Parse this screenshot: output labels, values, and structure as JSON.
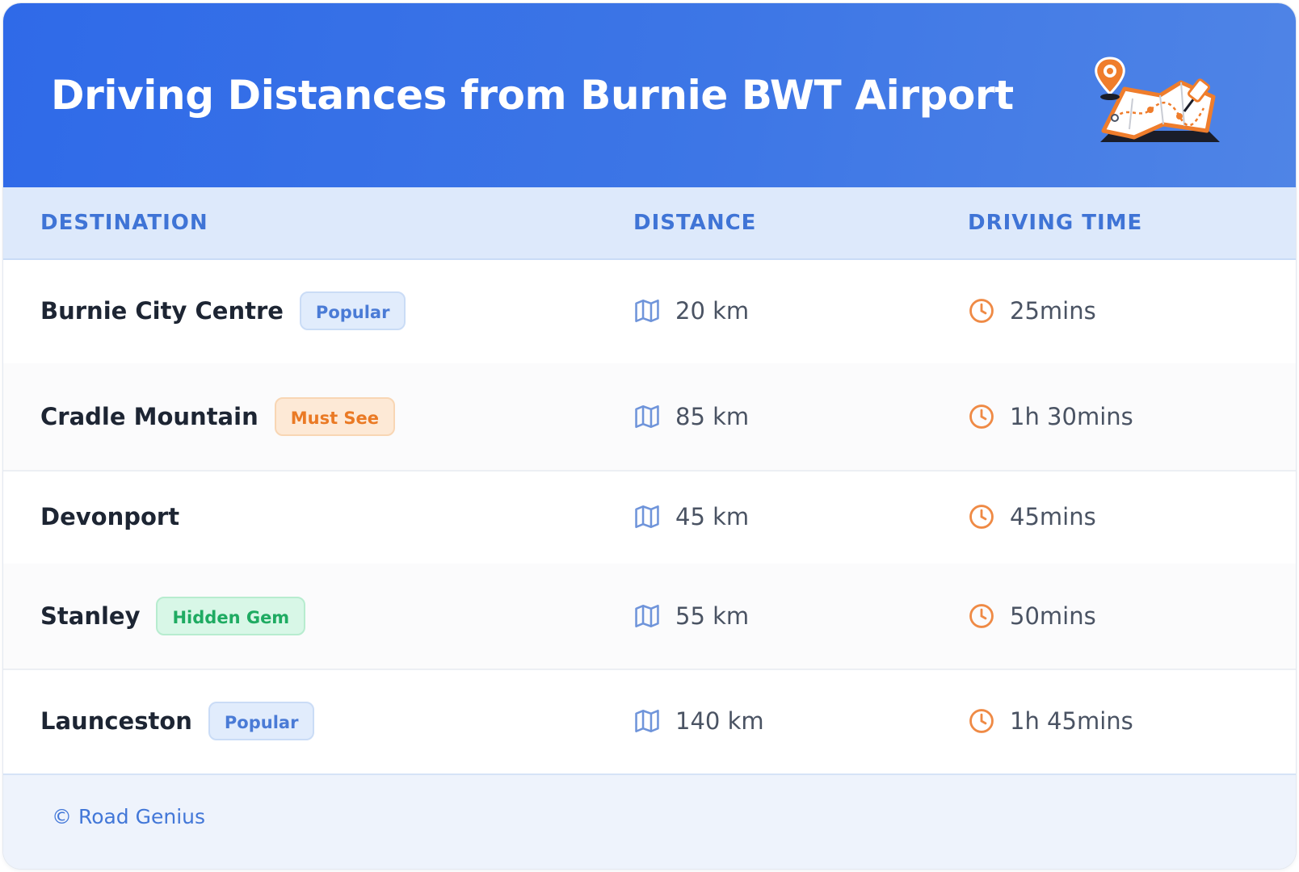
{
  "header": {
    "title": "Driving Distances from Burnie BWT Airport"
  },
  "table": {
    "columns": [
      "DESTINATION",
      "DISTANCE",
      "DRIVING TIME"
    ],
    "rows": [
      {
        "destination": "Burnie City Centre",
        "badge": "Popular",
        "badge_type": "popular",
        "distance": "20 km",
        "time": "25mins"
      },
      {
        "destination": "Cradle Mountain",
        "badge": "Must See",
        "badge_type": "mustsee",
        "distance": "85 km",
        "time": "1h 30mins"
      },
      {
        "destination": "Devonport",
        "badge": "",
        "badge_type": "",
        "distance": "45 km",
        "time": "45mins"
      },
      {
        "destination": "Stanley",
        "badge": "Hidden Gem",
        "badge_type": "gem",
        "distance": "55 km",
        "time": "50mins"
      },
      {
        "destination": "Launceston",
        "badge": "Popular",
        "badge_type": "popular",
        "distance": "140 km",
        "time": "1h 45mins"
      }
    ]
  },
  "footer": {
    "copyright": "© Road Genius"
  },
  "icons": {
    "distance": "map-icon",
    "time": "clock-icon",
    "header": "map-pin-illustration"
  },
  "colors": {
    "header_start": "#2f6ae8",
    "header_end": "#4f84e6",
    "accent_blue": "#3f74d6",
    "accent_orange": "#ea7a25",
    "accent_green": "#1fab62"
  }
}
